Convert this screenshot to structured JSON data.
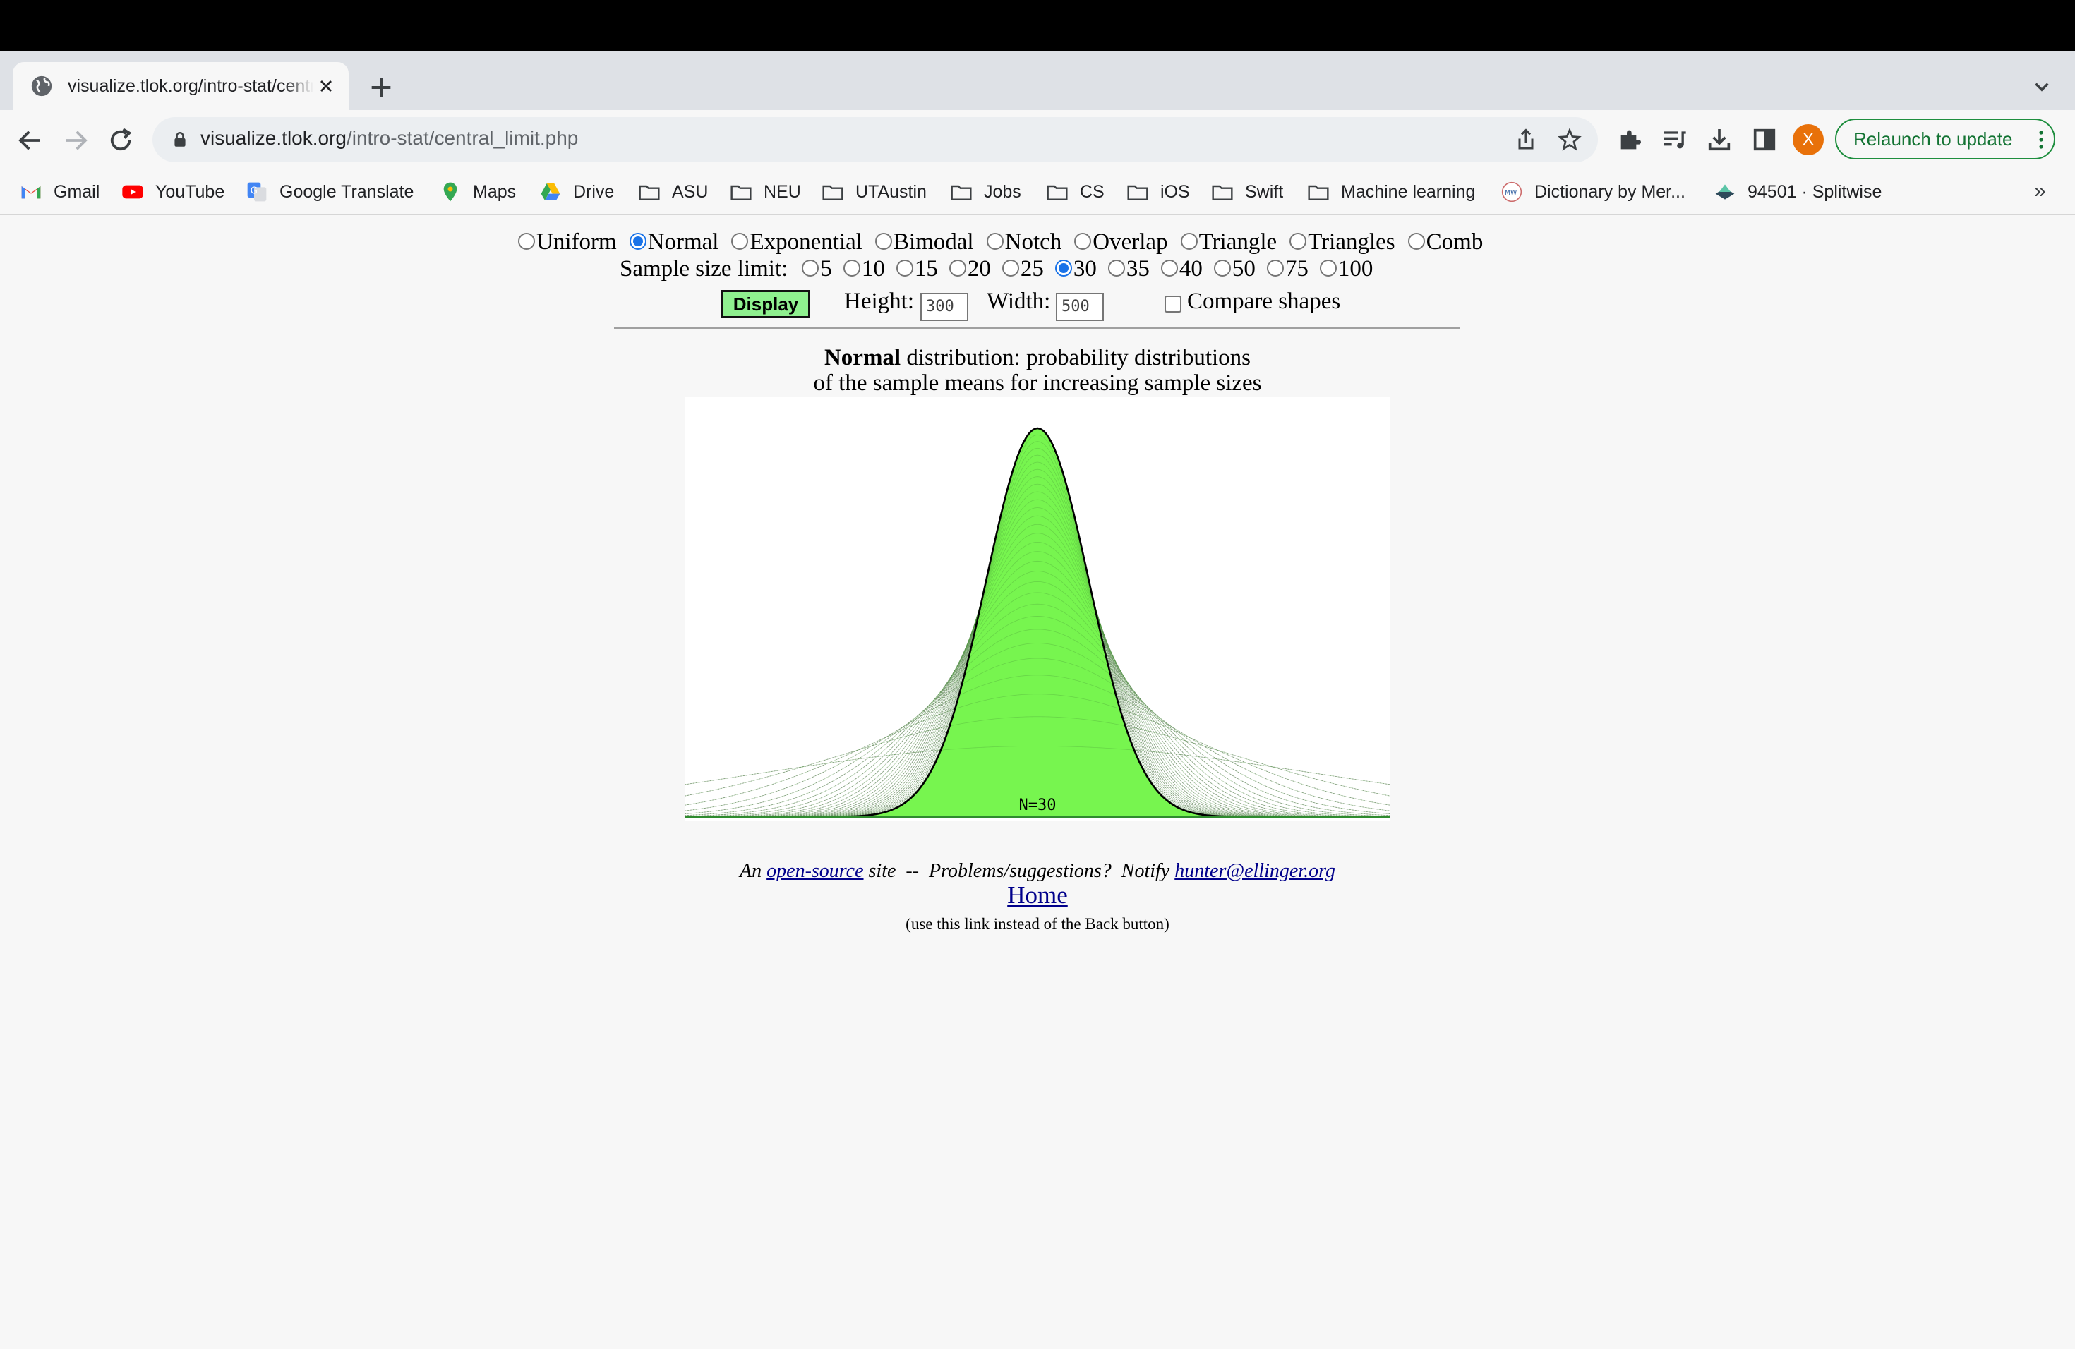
{
  "browser": {
    "tab_title": "visualize.tlok.org/intro-stat/central_limit.php",
    "url_host": "visualize.tlok.org",
    "url_path": "/intro-stat/central_limit.php",
    "profile_initial": "X",
    "relaunch_label": "Relaunch to update",
    "bookmarks": [
      "Gmail",
      "YouTube",
      "Google Translate",
      "Maps",
      "Drive",
      "ASU",
      "NEU",
      "UTAustin",
      "Jobs",
      "CS",
      "iOS",
      "Swift",
      "Machine learning",
      "Dictionary by Mer...",
      "94501 · Splitwise"
    ],
    "bookmarks_more": "»"
  },
  "controls": {
    "distributions": [
      {
        "label": "Uniform",
        "selected": false
      },
      {
        "label": "Normal",
        "selected": true
      },
      {
        "label": "Exponential",
        "selected": false
      },
      {
        "label": "Bimodal",
        "selected": false
      },
      {
        "label": "Notch",
        "selected": false
      },
      {
        "label": "Overlap",
        "selected": false
      },
      {
        "label": "Triangle",
        "selected": false
      },
      {
        "label": "Triangles",
        "selected": false
      },
      {
        "label": "Comb",
        "selected": false
      }
    ],
    "sample_size_label": "Sample size limit:",
    "sample_sizes": [
      {
        "label": "5",
        "selected": false
      },
      {
        "label": "10",
        "selected": false
      },
      {
        "label": "15",
        "selected": false
      },
      {
        "label": "20",
        "selected": false
      },
      {
        "label": "25",
        "selected": false
      },
      {
        "label": "30",
        "selected": true
      },
      {
        "label": "35",
        "selected": false
      },
      {
        "label": "40",
        "selected": false
      },
      {
        "label": "50",
        "selected": false
      },
      {
        "label": "75",
        "selected": false
      },
      {
        "label": "100",
        "selected": false
      }
    ],
    "display_button": "Display",
    "height_label": "Height:",
    "height_value": "300",
    "width_label": "Width:",
    "width_value": "500",
    "compare_label": "Compare shapes",
    "compare_checked": false
  },
  "chart": {
    "title_bold": "Normal",
    "title_rest": " distribution: probability distributions",
    "title_line2": "of the sample means for increasing sample sizes",
    "n_label": "N=30"
  },
  "chart_data": {
    "type": "area",
    "distribution": "Normal",
    "sample_sizes": [
      1,
      2,
      3,
      4,
      5,
      6,
      7,
      8,
      9,
      10,
      11,
      12,
      13,
      14,
      15,
      16,
      17,
      18,
      19,
      20,
      21,
      22,
      23,
      24,
      25,
      26,
      27,
      28,
      29,
      30
    ],
    "highlighted_n": 30,
    "fill_color": "#77f54f",
    "outline_color": "#000000",
    "other_curves_color": "#999999"
  },
  "footer": {
    "prefix": "An ",
    "link1": "open-source",
    "middle": " site  --  Problems/suggestions?  Notify ",
    "email": "hunter@ellinger.org",
    "home": "Home",
    "note": "(use this link instead of the Back button)"
  }
}
